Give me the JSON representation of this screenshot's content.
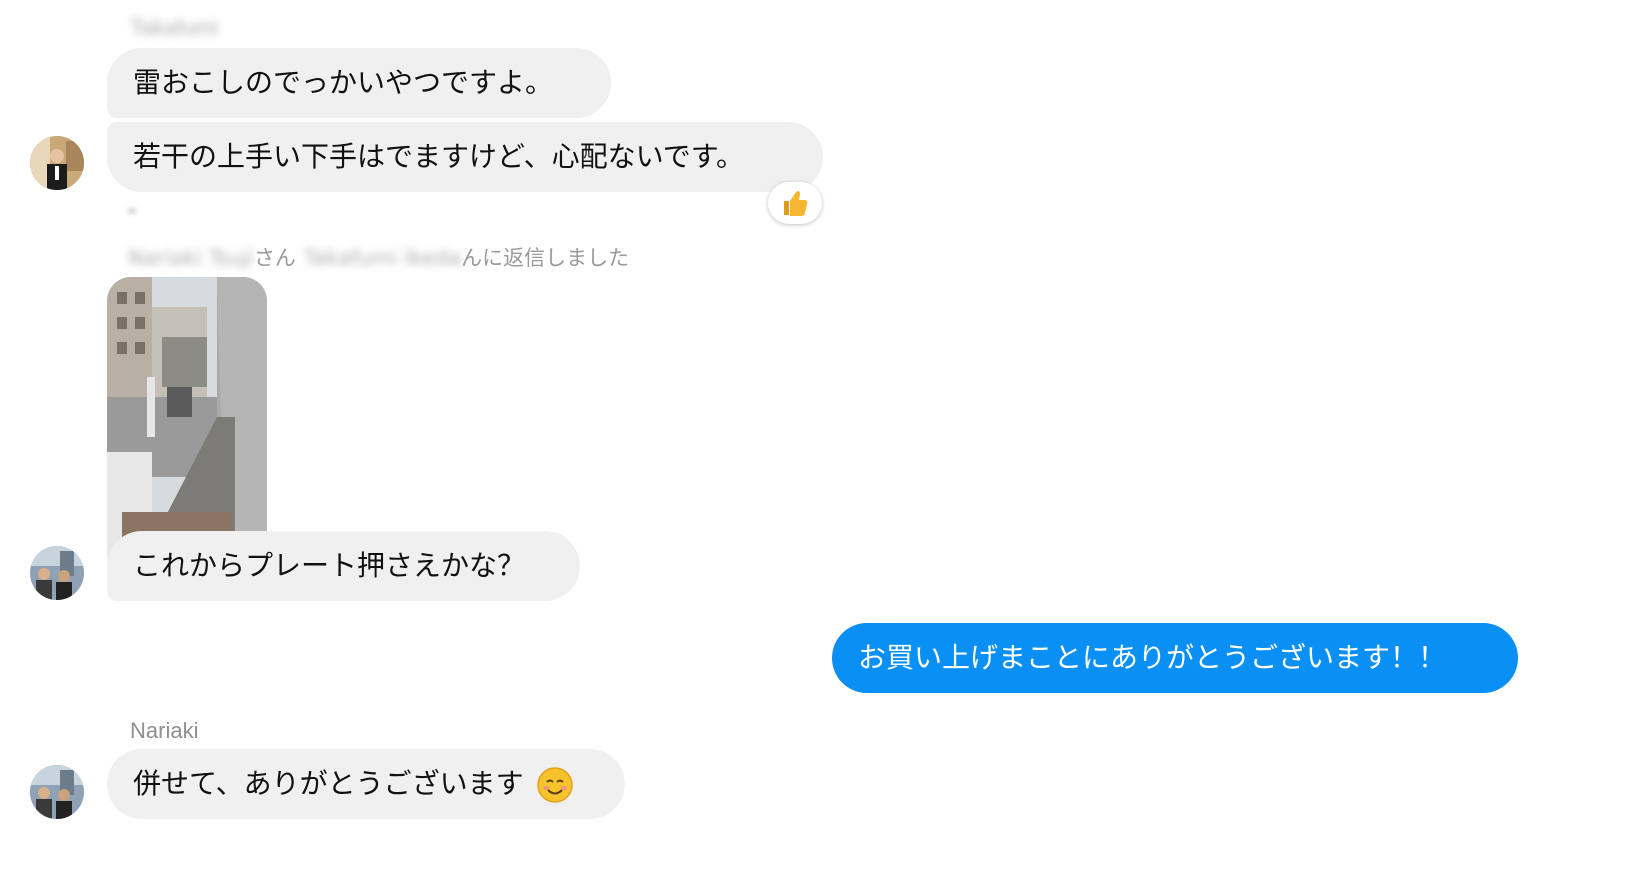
{
  "conversation": {
    "group1": {
      "sender_name": "Takafumi",
      "messages": [
        "雷おこしのでっかいやつですよ。",
        "若干の上手い下手はでますけど、心配ないです。"
      ],
      "reaction_icon": "thumbs-up-icon"
    },
    "reply_notice": {
      "blurred_prefix": "Nariaki Tsuji",
      "text_part1": "さん",
      "blurred_middle": "Takafumi Ikeda",
      "text_part2": "んに返信しました"
    },
    "group2": {
      "photo_description": "construction-site-photo",
      "message": "これからプレート押さえかな？"
    },
    "outgoing": {
      "message": "お買い上げまことにありがとうございます！！"
    },
    "group3": {
      "sender_name": "Nariaki",
      "message": "併せて、ありがとうございます",
      "emoji_icon": "smiling-face-icon"
    }
  },
  "colors": {
    "outgoing_bubble": "#0a8ff5",
    "incoming_bubble": "#f0f0f0",
    "reaction_thumb": "#f5b731"
  }
}
